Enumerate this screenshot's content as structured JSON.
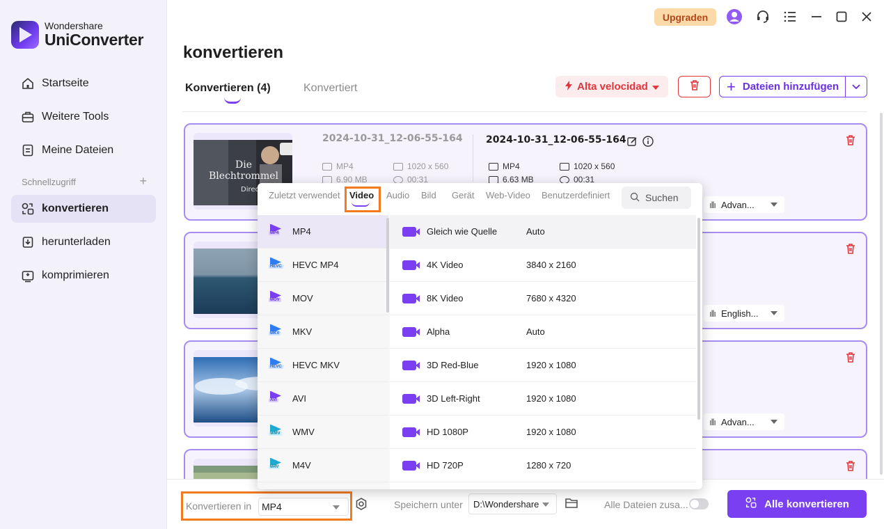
{
  "app": {
    "brand_small": "Wondershare",
    "brand_big": "UniConverter"
  },
  "sidebar": {
    "items": [
      {
        "label": "Startseite",
        "icon": "home-icon"
      },
      {
        "label": "Weitere Tools",
        "icon": "toolbox-icon"
      },
      {
        "label": "Meine Dateien",
        "icon": "file-icon"
      }
    ],
    "quick_access_label": "Schnellzugriff",
    "quick_items": [
      {
        "label": "konvertieren",
        "icon": "convert-icon",
        "active": true
      },
      {
        "label": "herunterladen",
        "icon": "download-icon"
      },
      {
        "label": "komprimieren",
        "icon": "compress-icon"
      }
    ]
  },
  "topbar": {
    "upgrade_label": "Upgraden"
  },
  "page": {
    "title": "konvertieren",
    "tab_active": "Konvertieren (4)",
    "tab_inactive": "Konvertiert",
    "speed_label": "Alta velocidad",
    "add_files_label": "Dateien hinzufügen"
  },
  "files": [
    {
      "src_name": "2024-10-31_12-06-55-164",
      "src_format": "MP4",
      "src_size": "6.90 MB",
      "src_res": "1020 x 560",
      "src_duration": "00:31",
      "out_name": "2024-10-31_12-06-55-164",
      "out_format": "MP4",
      "out_size": "6.63 MB",
      "out_res": "1020 x 560",
      "out_duration": "00:31",
      "audio": "Advan...",
      "thumb_text_1": "Die",
      "thumb_text_2": "Blechtrommel",
      "thumb_text_3": "Director"
    },
    {
      "audio": "English..."
    },
    {
      "audio": "Advan..."
    },
    {}
  ],
  "format_dropdown": {
    "tabs": [
      "Zuletzt verwendet",
      "Video",
      "Audio",
      "Bild",
      "Gerät",
      "Web-Video",
      "Benutzerdefiniert"
    ],
    "active_tab": "Video",
    "search_placeholder": "Suchen",
    "formats": [
      {
        "label": "MP4",
        "badge": "MP4",
        "color": "purple"
      },
      {
        "label": "HEVC MP4",
        "badge": "HEVC",
        "color": "blue"
      },
      {
        "label": "MOV",
        "badge": "MOV",
        "color": "purple"
      },
      {
        "label": "MKV",
        "badge": "MKV",
        "color": "blue"
      },
      {
        "label": "HEVC MKV",
        "badge": "HEVC",
        "color": "blue"
      },
      {
        "label": "AVI",
        "badge": "AVI",
        "color": "purple"
      },
      {
        "label": "WMV",
        "badge": "WMV",
        "color": "teal"
      },
      {
        "label": "M4V",
        "badge": "M4V",
        "color": "teal"
      }
    ],
    "presets": [
      {
        "name": "Gleich wie Quelle",
        "res": "Auto"
      },
      {
        "name": "4K Video",
        "res": "3840 x 2160"
      },
      {
        "name": "8K Video",
        "res": "7680 x 4320"
      },
      {
        "name": "Alpha",
        "res": "Auto"
      },
      {
        "name": "3D Red-Blue",
        "res": "1920 x 1080"
      },
      {
        "name": "3D Left-Right",
        "res": "1920 x 1080"
      },
      {
        "name": "HD 1080P",
        "res": "1920 x 1080"
      },
      {
        "name": "HD 720P",
        "res": "1280 x 720"
      }
    ]
  },
  "bottom": {
    "convert_in_label": "Konvertieren in",
    "convert_in_value": "MP4",
    "save_label": "Speichern unter",
    "save_value": "D:\\Wondershare",
    "merge_label": "Alle Dateien zusa...",
    "convert_all_label": "Alle konvertieren"
  },
  "colors": {
    "accent": "#7b3ff2",
    "danger": "#e1363c",
    "highlight": "#f47a20"
  }
}
